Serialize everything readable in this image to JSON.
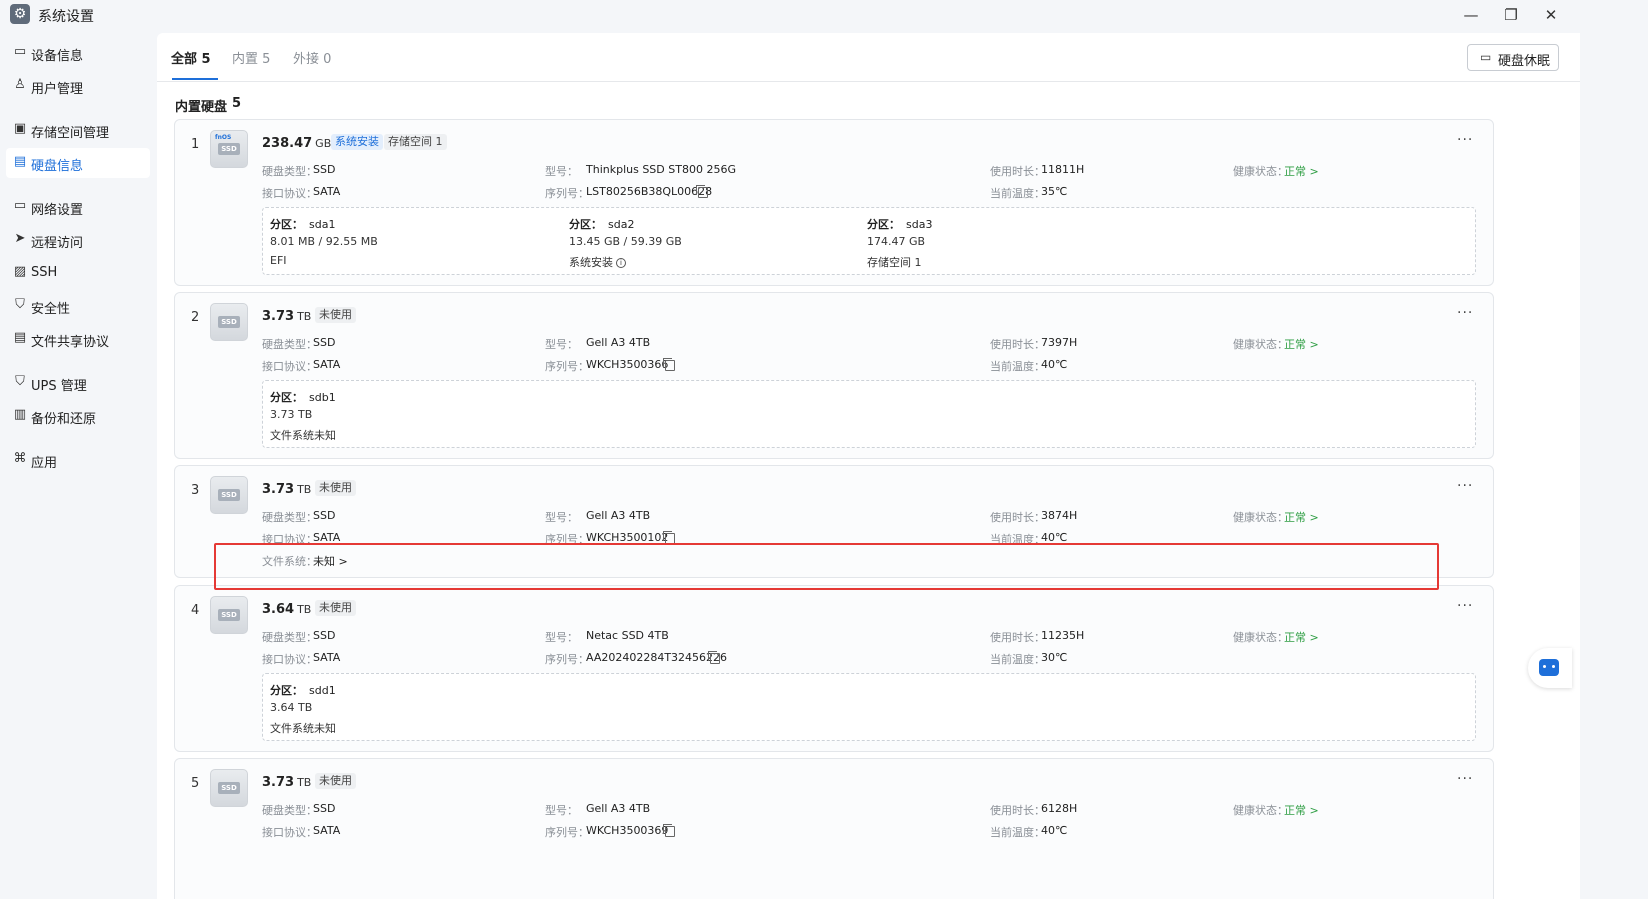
{
  "window": {
    "title": "系统设置",
    "min": "—",
    "max": "❐",
    "close": "✕"
  },
  "sidebar": [
    {
      "label": "设备信息",
      "icon": "monitor-icon",
      "glyph": "▭"
    },
    {
      "label": "用户管理",
      "icon": "user-icon",
      "glyph": "♙"
    },
    {
      "label": "存储空间管理",
      "icon": "storage-icon",
      "glyph": "▣"
    },
    {
      "label": "硬盘信息",
      "icon": "disk-icon",
      "glyph": "▤"
    },
    {
      "label": "网络设置",
      "icon": "network-icon",
      "glyph": "▭"
    },
    {
      "label": "远程访问",
      "icon": "send-icon",
      "glyph": "➤"
    },
    {
      "label": "SSH",
      "icon": "terminal-icon",
      "glyph": "▨"
    },
    {
      "label": "安全性",
      "icon": "shield-icon",
      "glyph": "⛉"
    },
    {
      "label": "文件共享协议",
      "icon": "file-share-icon",
      "glyph": "▤"
    },
    {
      "label": "UPS 管理",
      "icon": "ups-icon",
      "glyph": "⛉"
    },
    {
      "label": "备份和还原",
      "icon": "backup-icon",
      "glyph": "▥"
    },
    {
      "label": "应用",
      "icon": "apps-icon",
      "glyph": "⌘"
    }
  ],
  "tabs": [
    {
      "label": "全部 5"
    },
    {
      "label": "内置 5"
    },
    {
      "label": "外接 0"
    }
  ],
  "sleep_button": "硬盘休眠",
  "section": {
    "title": "内置硬盘",
    "count": "5"
  },
  "labels": {
    "type": "硬盘类型：",
    "iface": "接口协议：",
    "model": "型号：",
    "serial": "序列号：",
    "hours": "使用时长：",
    "temp": "当前温度：",
    "health": "健康状态：",
    "partition": "分区：",
    "fs": "文件系统："
  },
  "disks": [
    {
      "num": "1",
      "cap": "238.47",
      "unit": "GB",
      "tags": [
        "系统安装",
        "存储空间 1"
      ],
      "type": "SSD",
      "iface": "SATA",
      "model": "Thinkplus SSD ST800 256G",
      "serial": "LST80256B38QL00628",
      "hours": "11811H",
      "temp": "35℃",
      "health": "正常 >",
      "partitions": [
        {
          "name": "sda1",
          "l1": "8.01 MB / 92.55 MB",
          "l2": "EFI"
        },
        {
          "name": "sda2",
          "l1": "13.45 GB / 59.39 GB",
          "l2": "系统安装"
        },
        {
          "name": "sda3",
          "l1": "174.47 GB",
          "l2": "存储空间 1"
        }
      ]
    },
    {
      "num": "2",
      "cap": "3.73",
      "unit": "TB",
      "tags": [
        "未使用"
      ],
      "type": "SSD",
      "iface": "SATA",
      "model": "Gell A3 4TB",
      "serial": "WKCH3500366",
      "hours": "7397H",
      "temp": "40℃",
      "health": "正常 >",
      "partitions": [
        {
          "name": "sdb1",
          "l1": "3.73 TB",
          "l2": "文件系统未知"
        }
      ]
    },
    {
      "num": "3",
      "cap": "3.73",
      "unit": "TB",
      "tags": [
        "未使用"
      ],
      "type": "SSD",
      "iface": "SATA",
      "model": "Gell A3 4TB",
      "serial": "WKCH3500102",
      "hours": "3874H",
      "temp": "40℃",
      "health": "正常 >",
      "fs": "未知 >"
    },
    {
      "num": "4",
      "cap": "3.64",
      "unit": "TB",
      "tags": [
        "未使用"
      ],
      "type": "SSD",
      "iface": "SATA",
      "model": "Netac SSD 4TB",
      "serial": "AA202402284T32456226",
      "hours": "11235H",
      "temp": "30℃",
      "health": "正常 >",
      "partitions": [
        {
          "name": "sdd1",
          "l1": "3.64 TB",
          "l2": "文件系统未知"
        }
      ]
    },
    {
      "num": "5",
      "cap": "3.73",
      "unit": "TB",
      "tags": [
        "未使用"
      ],
      "type": "SSD",
      "iface": "SATA",
      "model": "Gell A3 4TB",
      "serial": "WKCH3500369",
      "hours": "6128H",
      "temp": "40℃",
      "health": "正常 >"
    }
  ],
  "ssd_badge": "SSD",
  "os_badge": "fnOS",
  "more": "···"
}
